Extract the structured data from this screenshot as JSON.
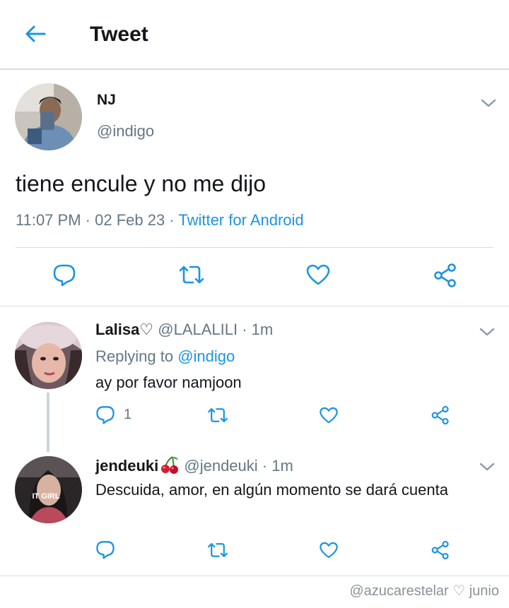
{
  "header": {
    "title": "Tweet"
  },
  "tweet": {
    "name": "NJ",
    "handle": "@indigo",
    "text": "tiene encule y no me dijo",
    "time": "11:07 PM",
    "date": "02 Feb 23",
    "source": "Twitter for Android"
  },
  "replies": [
    {
      "name": "Lalisa",
      "name_suffix": "♡",
      "handle": "@LALALILI",
      "time": "1m",
      "replying_prefix": "Replying to",
      "replying_to": "@indigo",
      "text": "ay por favor namjoon",
      "reply_count": "1"
    },
    {
      "name": "jendeuki",
      "handle": "@jendeuki",
      "time": "1m",
      "text": "Descuida, amor, en algún momento se dará cuenta",
      "avatar_label": "IT GIRL"
    }
  ],
  "watermark": "@azucarestelar ♡ junio",
  "colors": {
    "accent": "#1b95e0",
    "muted": "#657786",
    "icon": "#1b95e0"
  },
  "icons": [
    "back-arrow-icon",
    "chevron-down-icon",
    "reply-icon",
    "retweet-icon",
    "like-icon",
    "share-icon",
    "cherry-icon"
  ]
}
